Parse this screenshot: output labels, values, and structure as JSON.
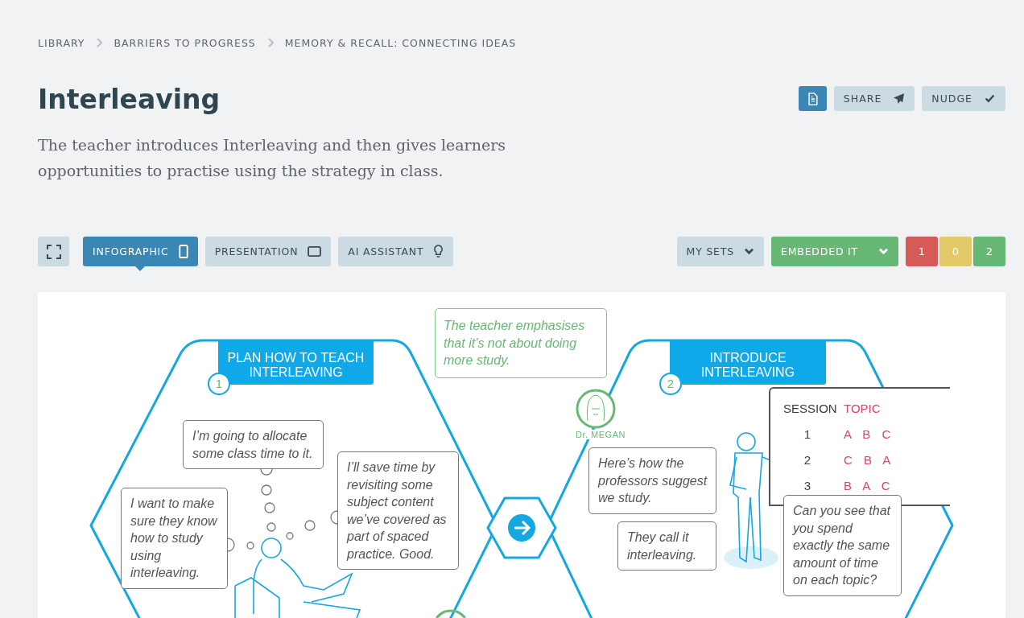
{
  "breadcrumb": [
    "LIBRARY",
    "BARRIERS TO PROGRESS",
    "MEMORY & RECALL: CONNECTING IDEAS"
  ],
  "title": "Interleaving",
  "description": "The teacher introduces Interleaving and then gives learners opportunities to practise using the strategy in class.",
  "actions": [
    {
      "kind": "document"
    },
    {
      "kind": "share",
      "label": "SHARE"
    },
    {
      "kind": "nudge",
      "label": "NUDGE"
    }
  ],
  "view_tabs": [
    {
      "kind": "infographic",
      "label": "INFOGRAPHIC",
      "selected": true
    },
    {
      "kind": "presentation",
      "label": "PRESENTATION",
      "selected": false
    },
    {
      "kind": "assistant",
      "label": "AI ASSISTANT",
      "selected": false
    }
  ],
  "sets_dropdown": "MY SETS",
  "status_dropdown": "EMBEDDED IT",
  "counts": [
    {
      "value": "1",
      "color": "#d65a55"
    },
    {
      "value": "0",
      "color": "#e3c96a"
    },
    {
      "value": "2",
      "color": "#67b875"
    }
  ],
  "infographic": {
    "steps": [
      {
        "number": "1",
        "title": "PLAN HOW TO TEACH INTERLEAVING",
        "bubbles": [
          "I’m going to allocate some class time to it.",
          "I want to make sure they know how to study using interleaving.",
          "I’ll save time by revisiting some subject content we’ve covered as part of spaced practice. Good."
        ]
      },
      {
        "number": "2",
        "title": "INTRODUCE INTERLEAVING",
        "bubbles": [
          "Here’s how the professors suggest we study.",
          "They call it interleaving.",
          "Can you see that you spend exactly the same amount of time on each topic?"
        ]
      }
    ],
    "expert_comment": "The teacher emphasises that it’s not about doing more study.",
    "expert_name": "Dr. MEGAN",
    "board": {
      "columns": [
        "SESSION",
        "TOPIC"
      ],
      "rows": [
        [
          "1",
          "A B C"
        ],
        [
          "2",
          "C B A"
        ],
        [
          "3",
          "B A C"
        ]
      ]
    }
  }
}
